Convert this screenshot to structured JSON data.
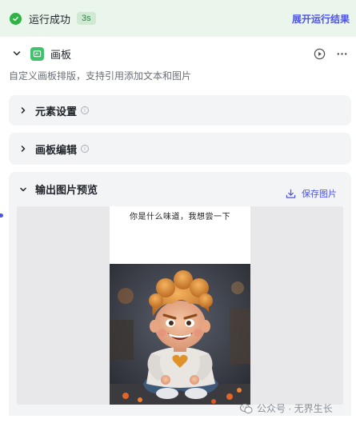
{
  "status": {
    "text": "运行成功",
    "time": "3s",
    "expand_label": "展开运行结果"
  },
  "node": {
    "title": "画板",
    "description": "自定义画板排版，支持引用添加文本和图片"
  },
  "sections": {
    "elements_label": "元素设置",
    "canvas_label": "画板编辑",
    "output_label": "输出图片预览"
  },
  "output": {
    "save_label": "保存图片",
    "caption": "你是什么味道，我想尝一下"
  },
  "watermark": {
    "text": "公众号 · 无界生长"
  },
  "colors": {
    "accent": "#4d53e8",
    "success": "#2fb344",
    "success_bg": "#eaf6ec",
    "panel_bg": "#f3f4f6"
  },
  "icons": {
    "status": "check-circle-icon",
    "collapse": "chevron-down-icon",
    "node": "canvas-icon",
    "run": "play-circle-icon",
    "more": "more-horizontal-icon",
    "info": "info-icon",
    "save": "download-icon",
    "watermark": "wechat-icon"
  }
}
